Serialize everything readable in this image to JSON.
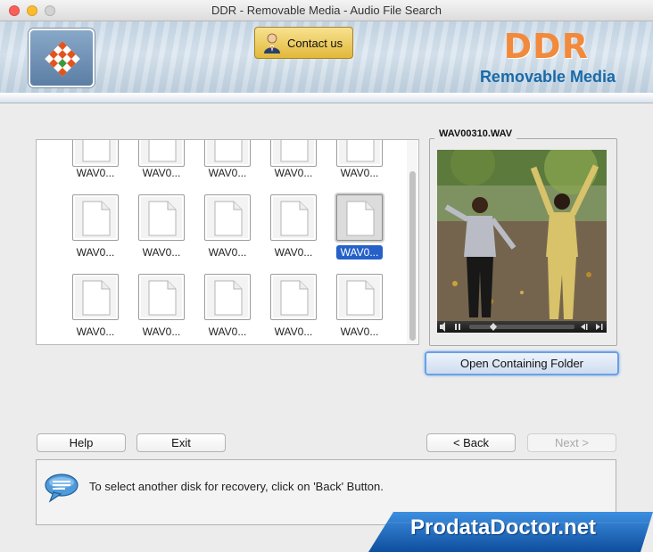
{
  "window": {
    "title": "DDR - Removable Media - Audio File Search"
  },
  "header": {
    "contact_label": "Contact us",
    "brand_title": "DDR",
    "brand_subtitle": "Removable Media"
  },
  "files": {
    "rows": [
      [
        "WAV0...",
        "WAV0...",
        "WAV0...",
        "WAV0...",
        "WAV0..."
      ],
      [
        "WAV0...",
        "WAV0...",
        "WAV0...",
        "WAV0...",
        "WAV0..."
      ],
      [
        "WAV0...",
        "WAV0...",
        "WAV0...",
        "WAV0...",
        "WAV0..."
      ]
    ],
    "selected": {
      "row": 1,
      "col": 4
    }
  },
  "preview": {
    "filename": "WAV00310.WAV",
    "open_folder_label": "Open Containing Folder"
  },
  "buttons": {
    "help": "Help",
    "exit": "Exit",
    "back": "< Back",
    "next": "Next >"
  },
  "status": {
    "message": "To select another disk for recovery, click on 'Back' Button."
  },
  "watermark": {
    "text": "ProdataDoctor.net"
  },
  "colors": {
    "accent": "#2661c9",
    "brand_orange": "#f18a3c",
    "brand_blue": "#1a6aa8",
    "contact_gold": "#e2b83a"
  }
}
